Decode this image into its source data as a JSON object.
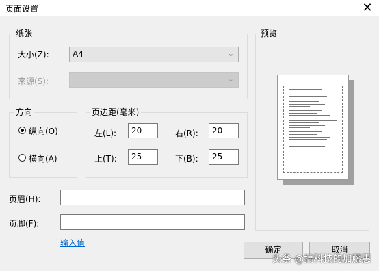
{
  "window": {
    "title": "页面设置",
    "close_glyph": "✕"
  },
  "paper": {
    "group_label": "纸张",
    "size_label": "大小(Z):",
    "size_value": "A4",
    "source_label": "来源(S):",
    "source_value": ""
  },
  "orientation": {
    "group_label": "方向",
    "portrait": "纵向(O)",
    "landscape": "横向(A)",
    "selected": "portrait"
  },
  "margins": {
    "group_label": "页边距(毫米)",
    "left_label": "左(L):",
    "left": "20",
    "right_label": "右(R):",
    "right": "20",
    "top_label": "上(T):",
    "top": "25",
    "bottom_label": "下(B):",
    "bottom": "25"
  },
  "header": {
    "label": "页眉(H):",
    "value": ""
  },
  "footer": {
    "label": "页脚(F):",
    "value": ""
  },
  "input_value_link": "输入值",
  "preview": {
    "label": "预览"
  },
  "buttons": {
    "ok": "确定",
    "cancel": "取消"
  },
  "watermark": "头条 @搞科技的加藤惠"
}
